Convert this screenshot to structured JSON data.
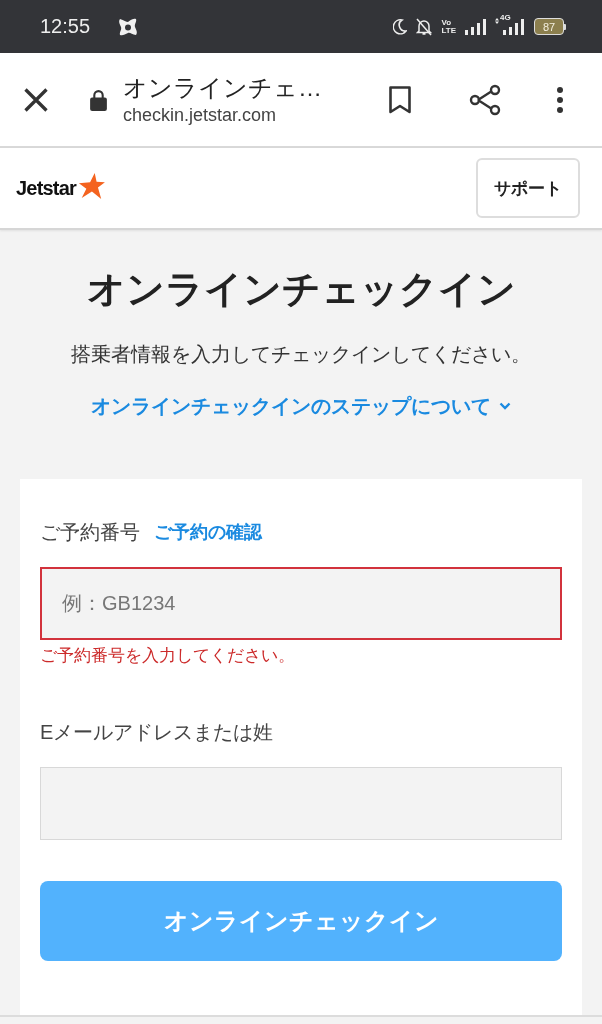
{
  "status_bar": {
    "time": "12:55",
    "volte": [
      "Vo",
      "LTE"
    ],
    "network_type": "4G",
    "battery": "87"
  },
  "browser_bar": {
    "page_title": "オンラインチェ…",
    "url": "checkin.jetstar.com"
  },
  "site_header": {
    "logo": "Jetstar",
    "support_button": "サポート"
  },
  "intro": {
    "heading": "オンラインチェックイン",
    "description": "搭乗者情報を入力してチェックインしてください。",
    "steps_link": {
      "label": "オンラインチェックインのステップについて",
      "expanded": false
    }
  },
  "form": {
    "fields": [
      {
        "label": "ご予約番号",
        "link": "ご予約の確認",
        "placeholder": "例：GB1234",
        "invalid": true,
        "error": "ご予約番号を入力してください。"
      },
      {
        "label": "Eメールアドレスまたは姓",
        "invalid": false
      }
    ],
    "submit_button": "オンラインチェックイン"
  }
}
